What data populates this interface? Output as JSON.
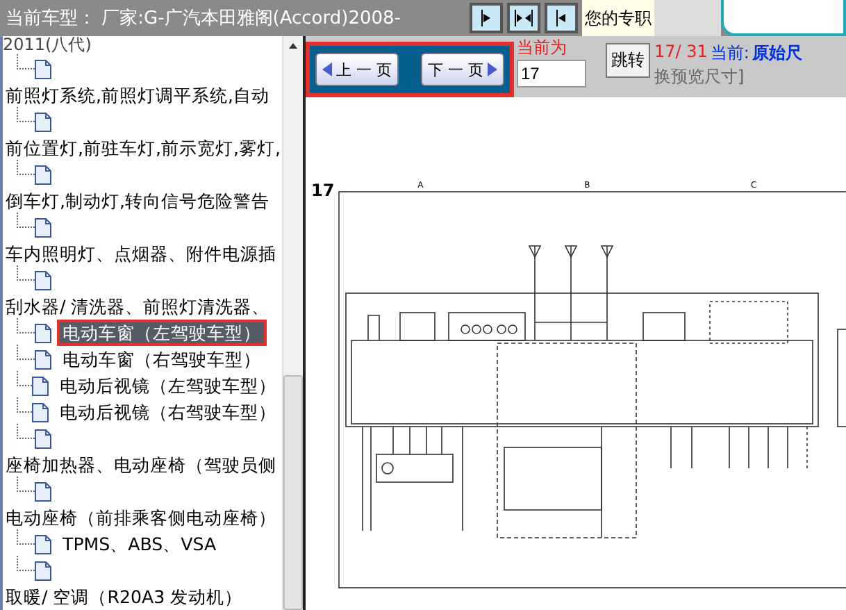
{
  "header": {
    "title": "当前车型： 厂家:G-广汽本田雅阁(Accord)2008-",
    "title_continued": "2011(八代)"
  },
  "toolbar": {
    "icon_buttons": [
      {
        "kind": "right"
      },
      {
        "kind": "split"
      },
      {
        "kind": "left"
      }
    ],
    "promo_text": "您的专职"
  },
  "nav": {
    "highlighted": true,
    "prev": "上 一 页",
    "next": "下 一 页",
    "page_prompt": "当前为",
    "page_input": "17",
    "jump": "跳转",
    "page_count": "17/ 31",
    "current_label": "当前:",
    "current_value": "原始尺",
    "size_hint": "换预览尺寸]"
  },
  "tree": [
    {
      "children": [
        {
          "selected": false,
          "highlighted": false
        }
      ]
    },
    {
      "label": "前照灯系统,前照灯调平系统,自动",
      "children": [
        {
          "selected": false,
          "highlighted": false
        }
      ]
    },
    {
      "label": "前位置灯,前驻车灯,前示宽灯,雾灯,",
      "children": [
        {
          "selected": false,
          "highlighted": false
        }
      ]
    },
    {
      "label": "倒车灯,制动灯,转向信号危险警告",
      "children": [
        {
          "selected": false,
          "highlighted": false
        }
      ]
    },
    {
      "label": "车内照明灯、点烟器、附件电源插",
      "children": [
        {
          "selected": false,
          "highlighted": false
        }
      ]
    },
    {
      "label": "刮水器/ 清洗器、前照灯清洗器、",
      "children": [
        {
          "label": "电动车窗（左驾驶车型）",
          "selected": true,
          "highlighted": true
        },
        {
          "label": "电动车窗（右驾驶车型）",
          "selected": false,
          "highlighted": false
        },
        {
          "label": "电动后视镜（左驾驶车型）",
          "selected": false,
          "highlighted": false
        },
        {
          "label": "电动后视镜（右驾驶车型）",
          "selected": false,
          "highlighted": false
        },
        {
          "selected": false,
          "highlighted": false
        }
      ]
    },
    {
      "label": "座椅加热器、电动座椅（驾驶员侧",
      "children": [
        {
          "selected": false,
          "highlighted": false
        }
      ]
    },
    {
      "label": "电动座椅（前排乘客侧电动座椅）",
      "children": [
        {
          "label": "TPMS、ABS、VSA",
          "selected": false,
          "highlighted": false
        },
        {
          "selected": false,
          "highlighted": false
        }
      ]
    },
    {
      "label": "取暖/ 空调（R20A3 发动机）"
    }
  ],
  "diagram": {
    "page_number": "17",
    "columns": [
      "A",
      "B",
      "C"
    ]
  }
}
